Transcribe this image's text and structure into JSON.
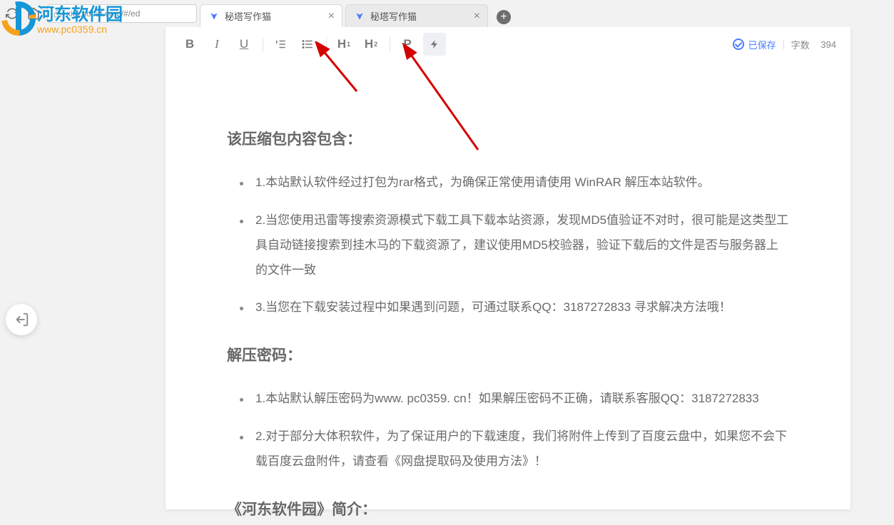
{
  "browser": {
    "url": "xiezuocat.com/#/ed",
    "tabs": [
      {
        "title": "秘塔写作猫"
      },
      {
        "title": "秘塔写作猫"
      }
    ]
  },
  "toolbar": {
    "bold": "B",
    "italic": "I",
    "underline": "U",
    "h1_main": "H",
    "h1_sub": "1",
    "h2_main": "H",
    "h2_sub": "2",
    "paragraph": "P"
  },
  "status": {
    "saved": "已保存",
    "wordcount_label": "字数",
    "wordcount_value": "394"
  },
  "document": {
    "heading1": "该压缩包内容包含：",
    "list1": [
      "1.本站默认软件经过打包为rar格式，为确保正常使用请使用 WinRAR 解压本站软件。",
      "2.当您使用迅雷等搜索资源模式下载工具下载本站资源，发现MD5值验证不对时，很可能是这类型工具自动链接搜索到挂木马的下载资源了，建议使用MD5校验器，验证下载后的文件是否与服务器上的文件一致",
      "3.当您在下载安装过程中如果遇到问题，可通过联系QQ：3187272833 寻求解决方法哦！"
    ],
    "heading2": "解压密码：",
    "list2": [
      "1.本站默认解压密码为www. pc0359. cn！如果解压密码不正确，请联系客服QQ：3187272833",
      "2.对于部分大体积软件，为了保证用户的下载速度，我们将附件上传到了百度云盘中，如果您不会下载百度云盘附件，请查看《网盘提取码及使用方法》！"
    ],
    "heading3": "《河东软件园》简介："
  },
  "watermark": {
    "line1": "河东软件园",
    "line2": "www.pc0359.cn"
  }
}
